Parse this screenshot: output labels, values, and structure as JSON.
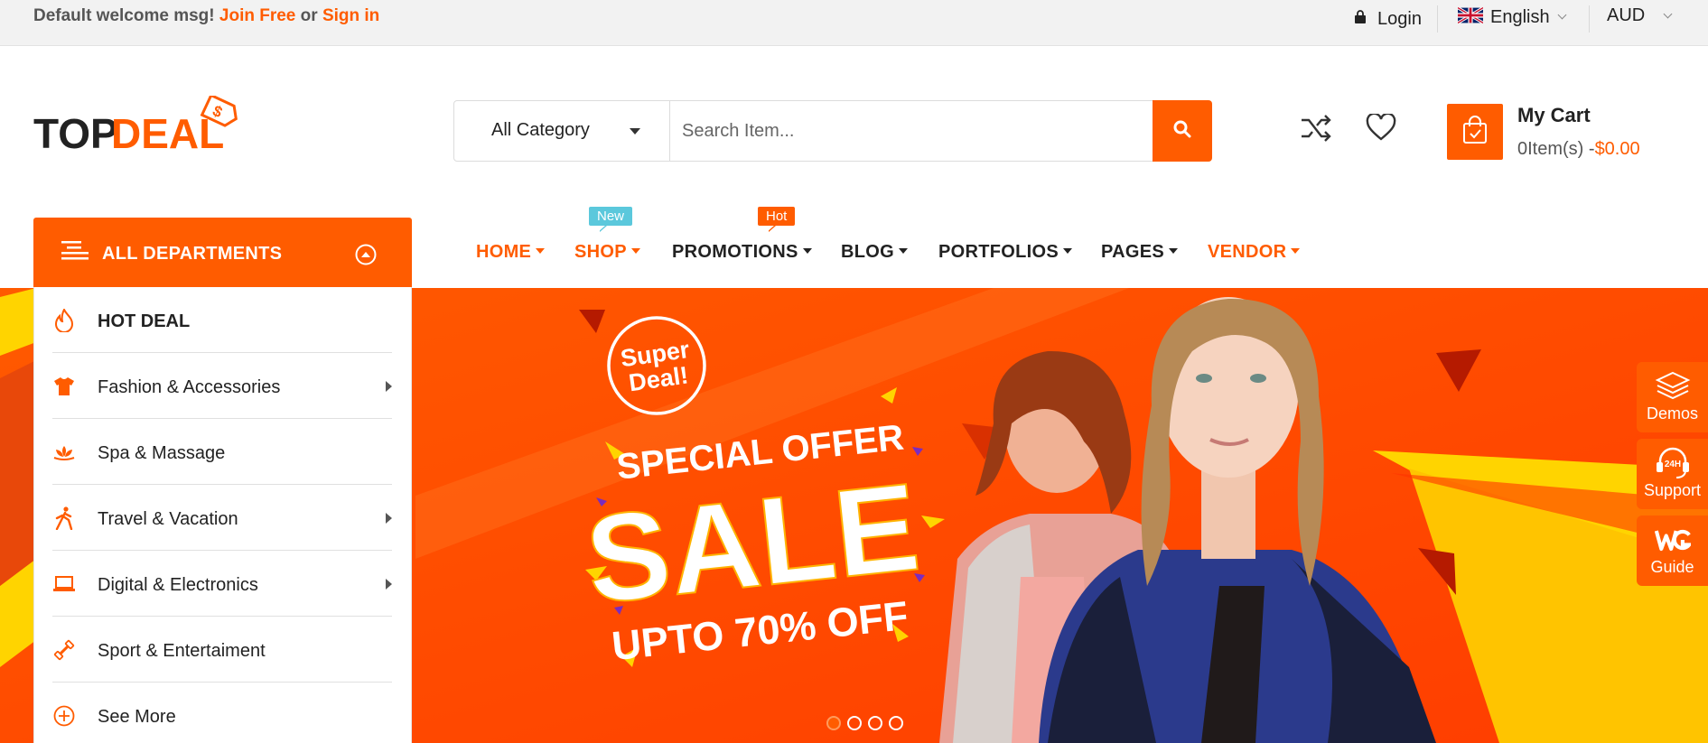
{
  "topbar": {
    "welcome_prefix": "Default welcome msg!",
    "join_link": "Join Free",
    "or_text": "or",
    "signin_link": "Sign in",
    "login": "Login",
    "language": "English",
    "currency": "AUD"
  },
  "header": {
    "logo_text_dark": "TOP",
    "logo_text_orange": "DEAL",
    "logo_tag": "$",
    "search": {
      "category": "All Category",
      "placeholder": "Search Item..."
    },
    "cart": {
      "title": "My Cart",
      "count": "0Item(s) -",
      "price": "$0.00"
    }
  },
  "departments": {
    "title": "ALL DEPARTMENTS",
    "items": [
      {
        "label": "HOT DEAL",
        "icon": "flame-icon",
        "has_sub": false
      },
      {
        "label": "Fashion & Accessories",
        "icon": "tshirt-icon",
        "has_sub": true
      },
      {
        "label": "Spa & Massage",
        "icon": "lotus-icon",
        "has_sub": false
      },
      {
        "label": "Travel & Vacation",
        "icon": "walking-icon",
        "has_sub": true
      },
      {
        "label": "Digital & Electronics",
        "icon": "laptop-icon",
        "has_sub": true
      },
      {
        "label": "Sport & Entertaiment",
        "icon": "dumbbell-icon",
        "has_sub": false
      },
      {
        "label": "See More",
        "icon": "plus-circle-icon",
        "has_sub": false
      }
    ]
  },
  "nav": {
    "items": [
      {
        "label": "HOME"
      },
      {
        "label": "SHOP",
        "badge": "New"
      },
      {
        "label": "PROMOTIONS",
        "badge": "Hot"
      },
      {
        "label": "BLOG"
      },
      {
        "label": "PORTFOLIOS"
      },
      {
        "label": "PAGES"
      },
      {
        "label": "VENDOR"
      }
    ]
  },
  "banner": {
    "badge_line1": "Super",
    "badge_line2": "Deal!",
    "headline": "SPECIAL OFFER",
    "big": "SALE",
    "sub": "UPTO 70% OFF",
    "slides": 4,
    "active_slide": 1
  },
  "side_widgets": [
    {
      "label": "Demos",
      "icon": "layers-icon"
    },
    {
      "label": "Support",
      "icon": "headset-24h-icon"
    },
    {
      "label": "Guide",
      "icon": "wg-icon"
    }
  ],
  "colors": {
    "accent": "#ff5c00",
    "badge_new": "#5bc8dc",
    "badge_hot": "#ff5c00",
    "banner_yellow": "#ffd400"
  }
}
